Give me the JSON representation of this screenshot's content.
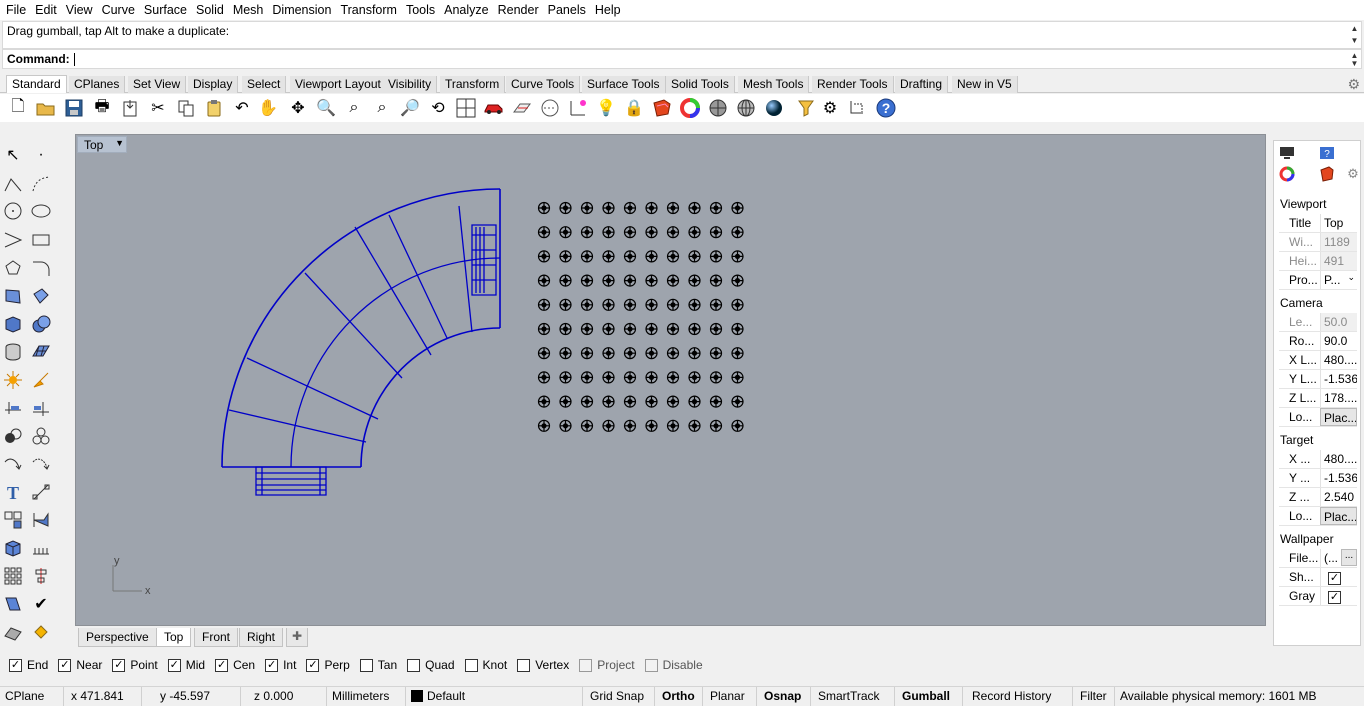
{
  "menu": [
    "File",
    "Edit",
    "View",
    "Curve",
    "Surface",
    "Solid",
    "Mesh",
    "Dimension",
    "Transform",
    "Tools",
    "Analyze",
    "Render",
    "Panels",
    "Help"
  ],
  "command": {
    "history": "Drag gumball, tap Alt to make a duplicate:",
    "prompt": "Command:"
  },
  "tabs": [
    "Standard",
    "CPlanes",
    "Set View",
    "Display",
    "Select",
    "Viewport Layout",
    "Visibility",
    "Transform",
    "Curve Tools",
    "Surface Tools",
    "Solid Tools",
    "Mesh Tools",
    "Render Tools",
    "Drafting",
    "New in V5"
  ],
  "toolbar_icons": [
    "new-file-icon",
    "open-file-icon",
    "save-icon",
    "print-icon",
    "import-icon",
    "cut-icon",
    "copy-icon",
    "paste-icon",
    "undo-icon",
    "pan-hand-icon",
    "rotate-view-icon",
    "zoom-dynamic-icon",
    "zoom-window-icon",
    "zoom-extents-icon",
    "zoom-selected-icon",
    "undo-view-icon",
    "viewport-layout-icon",
    "named-views-icon",
    "cplane-icon",
    "point-grid-icon",
    "light-icon",
    "lock-icon",
    "material-icon",
    "color-wheel-icon",
    "shaded-sphere-icon",
    "rendered-sphere-icon",
    "blue-sphere-icon",
    "filter-icon",
    "options-gear-icon",
    "dimension-icon",
    "help-icon"
  ],
  "viewport": {
    "name": "Top",
    "axis_x": "x",
    "axis_y": "y"
  },
  "viewport_tabs": [
    "Perspective",
    "Top",
    "Front",
    "Right"
  ],
  "osnaps": [
    {
      "label": "End",
      "checked": true
    },
    {
      "label": "Near",
      "checked": true
    },
    {
      "label": "Point",
      "checked": true
    },
    {
      "label": "Mid",
      "checked": true
    },
    {
      "label": "Cen",
      "checked": true
    },
    {
      "label": "Int",
      "checked": true
    },
    {
      "label": "Perp",
      "checked": true
    },
    {
      "label": "Tan",
      "checked": false
    },
    {
      "label": "Quad",
      "checked": false
    },
    {
      "label": "Knot",
      "checked": false
    },
    {
      "label": "Vertex",
      "checked": false
    },
    {
      "label": "Project",
      "checked": false
    },
    {
      "label": "Disable",
      "checked": false
    }
  ],
  "status": {
    "cplane": "CPlane",
    "x": "x 471.841",
    "y": "y -45.597",
    "z": "z 0.000",
    "units": "Millimeters",
    "layer": "Default",
    "grid_snap": "Grid Snap",
    "ortho": "Ortho",
    "planar": "Planar",
    "osnap": "Osnap",
    "smarttrack": "SmartTrack",
    "gumball": "Gumball",
    "record_history": "Record History",
    "filter": "Filter",
    "memory": "Available physical memory: 1601 MB"
  },
  "properties": {
    "viewport_header": "Viewport",
    "title_key": "Title",
    "title_val": "Top",
    "width_key": "Wi...",
    "width_val": "1189",
    "height_key": "Hei...",
    "height_val": "491",
    "proj_key": "Pro...",
    "proj_val": "P...",
    "camera_header": "Camera",
    "lens_key": "Le...",
    "lens_val": "50.0",
    "rot_key": "Ro...",
    "rot_val": "90.0",
    "xloc_key": "X L...",
    "xloc_val": "480....",
    "yloc_key": "Y L...",
    "yloc_val": "-1.536",
    "zloc_key": "Z L...",
    "zloc_val": "178....",
    "camloc_key": "Lo...",
    "camloc_val": "Plac...",
    "target_header": "Target",
    "tx_key": "X ...",
    "tx_val": "480....",
    "ty_key": "Y ...",
    "ty_val": "-1.536",
    "tz_key": "Z ...",
    "tz_val": "2.540",
    "tloc_key": "Lo...",
    "tloc_val": "Plac...",
    "wallpaper_header": "Wallpaper",
    "file_key": "File...",
    "file_val": "(...",
    "show_key": "Sh...",
    "gray_key": "Gray"
  },
  "colors": {
    "viewport_bg": "#9ea4ad",
    "curve_blue": "#0000c8"
  }
}
